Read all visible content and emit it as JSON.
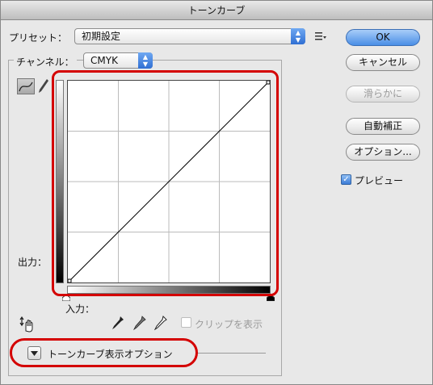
{
  "window": {
    "title": "トーンカーブ"
  },
  "preset": {
    "label": "プリセット：",
    "value": "初期設定"
  },
  "channel": {
    "label": "チャンネル：",
    "value": "CMYK"
  },
  "graph": {
    "output_label": "出力：",
    "input_label": "入力："
  },
  "clip": {
    "label": "クリップを表示"
  },
  "options": {
    "label": "トーンカーブ表示オプション"
  },
  "buttons": {
    "ok": "OK",
    "cancel": "キャンセル",
    "smooth": "滑らかに",
    "auto": "自動補正",
    "options": "オプション..."
  },
  "preview": {
    "label": "プレビュー",
    "checked": true
  },
  "colors": {
    "highlight": "#d40000",
    "accent": "#3a7ad6"
  }
}
